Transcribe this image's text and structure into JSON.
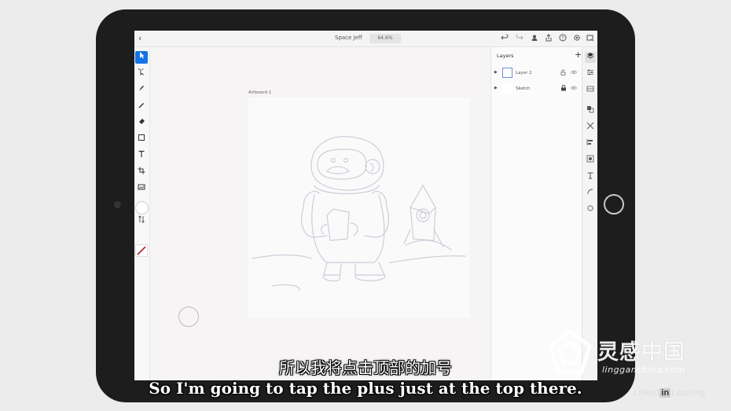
{
  "app": {
    "document_title": "Space Jeff",
    "zoom_level": "64.6%"
  },
  "topbar": {
    "back_glyph": "‹",
    "icons": [
      "undo-icon",
      "redo-icon",
      "share-user-icon",
      "export-icon",
      "help-icon",
      "settings-icon",
      "cloud-icon"
    ]
  },
  "canvas": {
    "artboard_label": "Artboard 1"
  },
  "layers_panel": {
    "title": "Layers",
    "add_glyph": "+",
    "layers": [
      {
        "name": "Layer 2",
        "selected": true,
        "locked": false
      },
      {
        "name": "Sketch",
        "selected": false,
        "locked": true
      }
    ]
  },
  "subtitles": {
    "chinese": "所以我将点击顶部的加号",
    "english": "So I'm going to tap the plus just at the top there."
  },
  "watermark": {
    "brand_cn": "灵感中国",
    "brand_en": "lingganchina.com",
    "linkedin_prefix": "Linked",
    "linkedin_in": "in",
    "linkedin_suffix": "Learning"
  },
  "colors": {
    "accent": "#1473e6",
    "selected_thumb_border": "#6c8ed8",
    "stroke_swatch": "#b22222"
  }
}
